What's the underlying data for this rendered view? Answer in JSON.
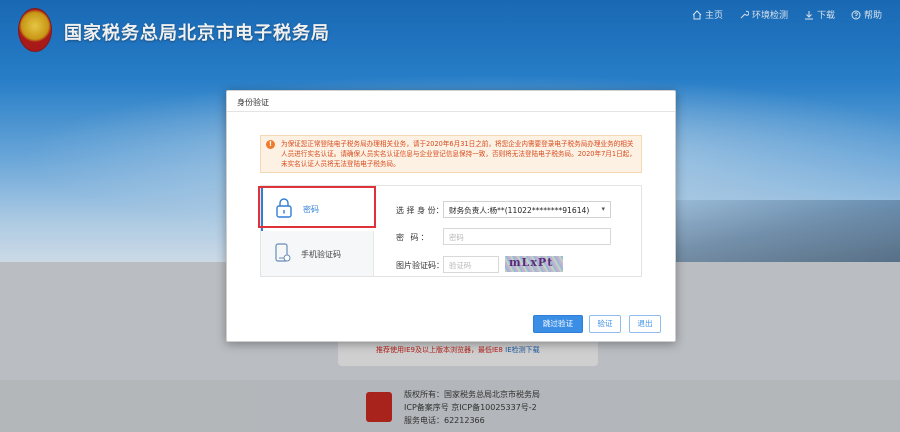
{
  "header": {
    "site_title": "国家税务总局北京市电子税务局",
    "nav": [
      {
        "label": "主页",
        "icon": "home-icon"
      },
      {
        "label": "环境检测",
        "icon": "wrench-icon"
      },
      {
        "label": "下载",
        "icon": "download-icon"
      },
      {
        "label": "帮助",
        "icon": "help-icon"
      }
    ]
  },
  "modal": {
    "title": "身份验证",
    "warning": "为保证您正常登陆电子税务局办理相关业务，请于2020年6月31日之前，将您企业内需要登录电子税务局办理业务的相关人员进行实名认证。请确保人员实名认证信息与企业登记信息保持一致，否则将无法登陆电子税务局。2020年7月1日起，未实名认证人员将无法登陆电子税务局。",
    "tabs": [
      {
        "label": "密码",
        "active": true
      },
      {
        "label": "手机验证码",
        "active": false
      }
    ],
    "form": {
      "identity_label": "选 择 身 份：",
      "identity_value": "财务负责人:杨**(11022********91614)",
      "password_label": "密    码：",
      "password_placeholder": "密码",
      "captcha_label": "图片验证码：",
      "captcha_placeholder": "验证码",
      "captcha_image_text": "mLxPt"
    },
    "buttons": {
      "skip": "跳过验证",
      "verify": "验证",
      "exit": "退出"
    }
  },
  "notice": {
    "text": "推荐使用IE9及以上版本浏览器，最低IE8",
    "link": "IE检测下载"
  },
  "footer": {
    "lines": [
      "版权所有：国家税务总局北京市税务局",
      "ICP备案序号 京ICP备10025337号-2",
      "服务电话：62212366"
    ]
  },
  "colors": {
    "primary": "#3a8ee6",
    "warning_text": "#d64a1a",
    "highlight": "#e0323b"
  }
}
